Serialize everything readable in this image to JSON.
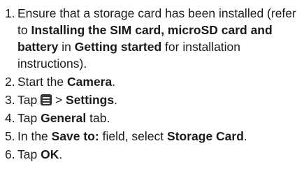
{
  "steps": [
    {
      "number": "1.",
      "parts": [
        {
          "t": "Ensure that a storage card has been installed (refer to ",
          "b": false
        },
        {
          "t": "Installing the SIM card, microSD card and battery",
          "b": true
        },
        {
          "t": " in ",
          "b": false
        },
        {
          "t": "Getting started",
          "b": true
        },
        {
          "t": " for installation instructions).",
          "b": false
        }
      ]
    },
    {
      "number": "2.",
      "parts": [
        {
          "t": "Start the ",
          "b": false
        },
        {
          "t": "Camera",
          "b": true
        },
        {
          "t": ".",
          "b": false
        }
      ]
    },
    {
      "number": "3.",
      "parts": [
        {
          "t": "Tap ",
          "b": false
        },
        {
          "icon": "menu-icon"
        },
        {
          "t": " > ",
          "b": false
        },
        {
          "t": "Settings",
          "b": true
        },
        {
          "t": ".",
          "b": false
        }
      ]
    },
    {
      "number": "4.",
      "parts": [
        {
          "t": "Tap ",
          "b": false
        },
        {
          "t": "General",
          "b": true
        },
        {
          "t": " tab.",
          "b": false
        }
      ]
    },
    {
      "number": "5.",
      "parts": [
        {
          "t": "In the ",
          "b": false
        },
        {
          "t": "Save to:",
          "b": true
        },
        {
          "t": " field, select ",
          "b": false
        },
        {
          "t": "Storage Card",
          "b": true
        },
        {
          "t": ".",
          "b": false
        }
      ]
    },
    {
      "number": "6.",
      "parts": [
        {
          "t": "Tap ",
          "b": false
        },
        {
          "t": "OK",
          "b": true
        },
        {
          "t": ".",
          "b": false
        }
      ]
    }
  ]
}
